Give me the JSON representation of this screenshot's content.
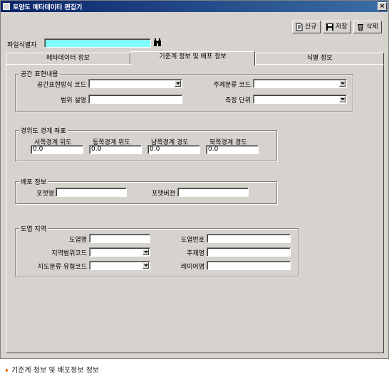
{
  "window": {
    "title": "토양도 메타데이터 편집기",
    "close_label": "×"
  },
  "toolbar": {
    "new_label": "신규",
    "save_label": "저장",
    "delete_label": "삭제"
  },
  "file_id": {
    "label": "파일식별자",
    "value": "",
    "search_icon": "binoculars-icon"
  },
  "tabs": [
    {
      "label": "메타데이터 정보"
    },
    {
      "label": "기준계 정보 및 배포 정보"
    },
    {
      "label": "식별 정보"
    }
  ],
  "spatial": {
    "title": "공간 표현내용",
    "method_code_label": "공간표현방식 코드",
    "method_code_value": "",
    "topic_code_label": "주제분류 코드",
    "topic_code_value": "",
    "extent_desc_label": "범위 설명",
    "extent_desc_value": "",
    "unit_label": "측정 단위",
    "unit_value": ""
  },
  "bbox": {
    "title": "경위도 경계 좌표",
    "west_label": "서쪽경계 위도",
    "west_value": "0.0",
    "east_label": "동쪽경계 위도",
    "east_value": "0.0",
    "south_label": "남쪽경계 경도",
    "south_value": "0.0",
    "north_label": "북쪽경계 경도",
    "north_value": "0.0"
  },
  "distribution": {
    "title": "배포 정보",
    "format_label": "포맷명",
    "format_value": "",
    "version_label": "포맷버젼",
    "version_value": ""
  },
  "map_sheet": {
    "title": "도엽 지역",
    "sheet_name_label": "도엽명",
    "sheet_name_value": "",
    "sheet_no_label": "도엽번호",
    "sheet_no_value": "",
    "region_code_label": "지역범위코드",
    "region_code_value": "",
    "subject_label": "주제명",
    "subject_value": "",
    "map_type_label": "지도분류 유형코드",
    "map_type_value": "",
    "layer_label": "레이어명",
    "layer_value": ""
  },
  "caption": "기준계 정보 및 배포정보 정보",
  "colors": {
    "title_start": "#0a246a",
    "title_end": "#3b6ea5",
    "file_id_field": "#80ffff",
    "face": "#d6d3ce"
  }
}
